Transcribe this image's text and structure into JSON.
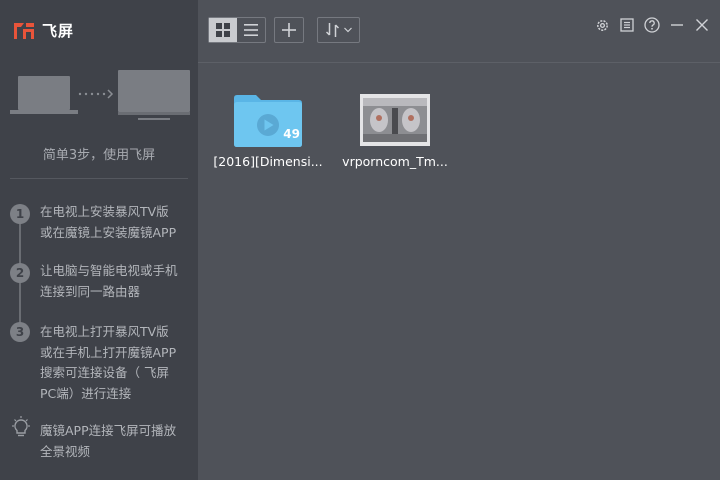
{
  "app": {
    "name": "飞屏"
  },
  "sidebar": {
    "intro": "简单3步，使用飞屏",
    "steps": [
      {
        "num": "1",
        "lines": [
          "在电视上安装暴风TV版",
          "或在魔镜上安装魔镜APP"
        ]
      },
      {
        "num": "2",
        "lines": [
          "让电脑与智能电视或手机",
          "连接到同一路由器"
        ]
      },
      {
        "num": "3",
        "lines": [
          "在电视上打开暴风TV版",
          "或在手机上打开魔镜APP",
          "搜索可连接设备（ 飞屏",
          "PC端）进行连接"
        ]
      }
    ],
    "tip": {
      "lines": [
        "魔镜APP连接飞屏可播放",
        "全景视频"
      ],
      "icon": "lightbulb-icon"
    }
  },
  "toolbar": {
    "view_grid": "grid-view-icon",
    "view_list": "list-view-icon",
    "add": "plus-icon",
    "sort": "sort-icon",
    "sort_dropdown": "chevron-down-icon"
  },
  "window": {
    "settings": "gear-icon",
    "menu": "menu-icon",
    "help": "help-icon",
    "minimize": "minimize-icon",
    "close": "close-icon"
  },
  "files": [
    {
      "name": "[2016][Dimensi...",
      "type": "folder",
      "count": "49"
    },
    {
      "name": "vrporncom_Tm...",
      "type": "video"
    }
  ],
  "colors": {
    "sidebar": "#3f4249",
    "main": "#4f5259",
    "folder": "#6ec6f0",
    "logo_accent": "#e8543a"
  }
}
